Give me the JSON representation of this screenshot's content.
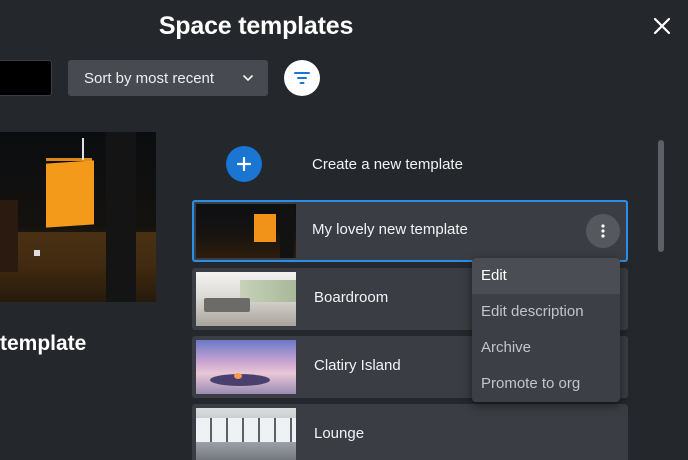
{
  "header": {
    "title": "Space templates"
  },
  "toolbar": {
    "sort_label": "Sort by most recent"
  },
  "left_panel": {
    "title_text": "template"
  },
  "create": {
    "label": "Create a new template"
  },
  "templates": [
    {
      "label": "My lovely new template",
      "selected": true
    },
    {
      "label": "Boardroom",
      "selected": false
    },
    {
      "label": "Clatiry Island",
      "selected": false
    },
    {
      "label": "Lounge",
      "selected": false
    }
  ],
  "context_menu": {
    "items": [
      "Edit",
      "Edit description",
      "Archive",
      "Promote to org"
    ],
    "active_index": 0
  },
  "icons": {
    "close": "close-icon",
    "filter": "filter-icon",
    "sort": "chevron-down-icon",
    "create": "plus-icon",
    "more": "more-vertical-icon"
  },
  "colors": {
    "background": "#24272b",
    "accent_blue": "#1a76d2",
    "selection_border": "#2a8fe6",
    "card": "#3a3d43",
    "menu": "#3c3f45"
  }
}
